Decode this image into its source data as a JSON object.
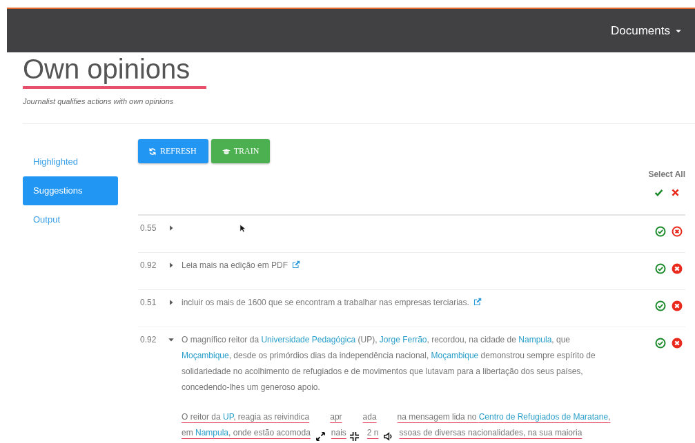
{
  "navbar": {
    "menu": "Documents"
  },
  "header": {
    "title": "Own opinions",
    "subtitle": "Journalist qualifies actions with own opinions"
  },
  "sidebar": {
    "items": [
      {
        "label": "Highlighted",
        "selected": false
      },
      {
        "label": "Suggestions",
        "selected": true
      },
      {
        "label": "Output",
        "selected": false
      }
    ]
  },
  "toolbar": {
    "buttons": [
      {
        "kind": "refresh",
        "label": "REFRESH"
      },
      {
        "kind": "train",
        "label": "TRAIN"
      }
    ]
  },
  "select_all": {
    "label": "Select All"
  },
  "rows": [
    {
      "score": "0.55",
      "expanded": false,
      "link": false,
      "reject_filled": false,
      "paragraphs": []
    },
    {
      "score": "0.92",
      "expanded": false,
      "link": true,
      "reject_filled": true,
      "paragraphs": [
        {
          "highlighted": false,
          "lines": [
            [
              {
                "kind": "text",
                "text": "Leia mais na edição em PDF"
              }
            ]
          ]
        }
      ]
    },
    {
      "score": "0.51",
      "expanded": false,
      "link": true,
      "reject_filled": true,
      "paragraphs": [
        {
          "highlighted": false,
          "lines": [
            [
              {
                "kind": "text",
                "text": "incluir os mais de 1600 que se encontram a trabalhar nas empresas terciarias."
              }
            ]
          ]
        }
      ]
    },
    {
      "score": "0.92",
      "expanded": true,
      "link": false,
      "reject_filled": true,
      "paragraphs": [
        {
          "highlighted": false,
          "lines": [
            [
              {
                "kind": "text",
                "text": "O magnífico reitor da "
              },
              {
                "kind": "entity",
                "text": "Universidade Pedagógica"
              },
              {
                "kind": "text",
                "text": " (UP), "
              },
              {
                "kind": "entity",
                "text": "Jorge Ferrão"
              },
              {
                "kind": "text",
                "text": ", recordou, na cidade de "
              },
              {
                "kind": "entity",
                "text": "Nampula"
              },
              {
                "kind": "text",
                "text": ", que"
              }
            ],
            [
              {
                "kind": "entity",
                "text": "Moçambique"
              },
              {
                "kind": "text",
                "text": ", desde os primórdios dias da independência nacional, "
              },
              {
                "kind": "entity",
                "text": "Moçambique"
              },
              {
                "kind": "text",
                "text": " demonstrou sempre espírito de"
              }
            ],
            [
              {
                "kind": "text",
                "text": "solidariedade no acolhimento de refugiados e de movimentos que lutavam para a libertação dos seus países,"
              }
            ],
            [
              {
                "kind": "text",
                "text": "concedendo-lhes um generoso apoio."
              }
            ]
          ]
        },
        {
          "highlighted": true,
          "lines": [
            [
              {
                "kind": "text",
                "text": "O reitor da "
              },
              {
                "kind": "entity",
                "text": "UP"
              },
              {
                "kind": "text",
                "text": ", reagia as reivindica"
              },
              {
                "kind": "gap"
              },
              {
                "kind": "text",
                "text": "apr"
              },
              {
                "kind": "gap"
              },
              {
                "kind": "text",
                "text": "ada"
              },
              {
                "kind": "gap"
              },
              {
                "kind": "text",
                "text": "na mensagem lida no "
              },
              {
                "kind": "entity",
                "text": "Centro de Refugiados de Maratane"
              },
              {
                "kind": "text",
                "text": ","
              }
            ],
            [
              {
                "kind": "text",
                "text": "em "
              },
              {
                "kind": "entity",
                "text": "Nampula"
              },
              {
                "kind": "text",
                "text": ", onde estão acomoda"
              },
              {
                "kind": "gap"
              },
              {
                "kind": "text",
                "text": "nais"
              },
              {
                "kind": "gap"
              },
              {
                "kind": "text",
                "text": "2 n"
              },
              {
                "kind": "gap"
              },
              {
                "kind": "text",
                "text": "ssoas de diversas nacionalidades, na sua maioria"
              }
            ]
          ]
        }
      ]
    }
  ]
}
